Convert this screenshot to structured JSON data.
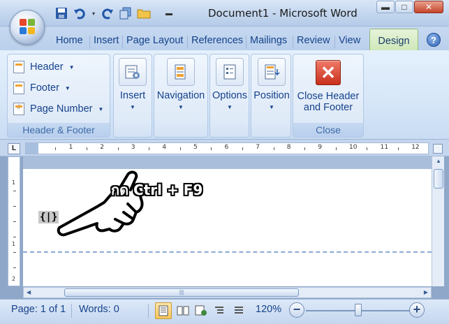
{
  "window": {
    "title": "Document1 - Microsoft Word",
    "controls": {
      "minimize": "▬",
      "maximize": "□",
      "close": "✕"
    }
  },
  "quick_access": {
    "icons": [
      "save-icon",
      "undo-icon",
      "dropdown-icon",
      "redo-icon",
      "copy-icon",
      "open-folder-icon",
      "customize-icon"
    ]
  },
  "tabs": [
    {
      "label": "Home"
    },
    {
      "label": "Insert"
    },
    {
      "label": "Page Layout"
    },
    {
      "label": "References"
    },
    {
      "label": "Mailings"
    },
    {
      "label": "Review"
    },
    {
      "label": "View"
    },
    {
      "label": "Design",
      "active": true
    }
  ],
  "help": "?",
  "ribbon": {
    "header_footer_group": {
      "label": "Header & Footer",
      "items": [
        {
          "label": "Header"
        },
        {
          "label": "Footer"
        },
        {
          "label": "Page Number"
        }
      ]
    },
    "insert": {
      "label": "Insert"
    },
    "navigation": {
      "label": "Navigation"
    },
    "options": {
      "label": "Options"
    },
    "position": {
      "label": "Position"
    },
    "close_group": {
      "label": "Close",
      "button_line1": "Close Header",
      "button_line2": "and Footer"
    }
  },
  "ruler": {
    "corner": "L",
    "numbers": [
      "1",
      "2",
      "3",
      "4",
      "5",
      "6",
      "7",
      "8",
      "9",
      "10",
      "11",
      "12"
    ]
  },
  "vertical_ruler": {
    "numbers": [
      "1",
      "1",
      "2"
    ]
  },
  "document": {
    "field_code": "{|}",
    "hint": "กด Ctrl + F9"
  },
  "scrollbar": {
    "thumb_grip": "|||"
  },
  "statusbar": {
    "page": "Page: 1 of 1",
    "words": "Words: 0",
    "zoom": "120%",
    "zoom_minus": "−",
    "zoom_plus": "+"
  },
  "colors": {
    "accent_blue": "#15428b",
    "design_tab": "#cfe8b9",
    "close_button": "#c8301c",
    "field_shading": "#c8c8c8"
  }
}
